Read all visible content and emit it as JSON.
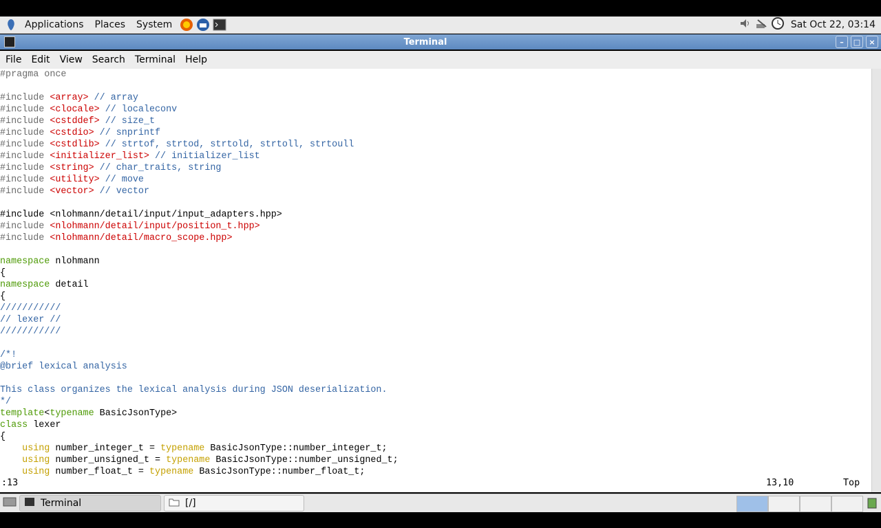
{
  "topbar": {
    "menus": [
      "Applications",
      "Places",
      "System"
    ],
    "clock": "Sat Oct 22, 03:14"
  },
  "window": {
    "title": "Terminal"
  },
  "menubar": [
    "File",
    "Edit",
    "View",
    "Search",
    "Terminal",
    "Help"
  ],
  "code": [
    [
      {
        "t": "#pragma once",
        "c": "pre"
      }
    ],
    [],
    [
      {
        "t": "#include ",
        "c": "pre"
      },
      {
        "t": "<array>",
        "c": "str"
      },
      {
        "t": " // array",
        "c": "com"
      }
    ],
    [
      {
        "t": "#include ",
        "c": "pre"
      },
      {
        "t": "<clocale>",
        "c": "str"
      },
      {
        "t": " // localeconv",
        "c": "com"
      }
    ],
    [
      {
        "t": "#include ",
        "c": "pre"
      },
      {
        "t": "<cstddef>",
        "c": "str"
      },
      {
        "t": " // size_t",
        "c": "com"
      }
    ],
    [
      {
        "t": "#include ",
        "c": "pre"
      },
      {
        "t": "<cstdio>",
        "c": "str"
      },
      {
        "t": " // snprintf",
        "c": "com"
      }
    ],
    [
      {
        "t": "#include ",
        "c": "pre"
      },
      {
        "t": "<cstdlib>",
        "c": "str"
      },
      {
        "t": " // strtof, strtod, strtold, strtoll, strtoull",
        "c": "com"
      }
    ],
    [
      {
        "t": "#include ",
        "c": "pre"
      },
      {
        "t": "<initializer_list>",
        "c": "str"
      },
      {
        "t": " // initializer_list",
        "c": "com"
      }
    ],
    [
      {
        "t": "#include ",
        "c": "pre"
      },
      {
        "t": "<string>",
        "c": "str"
      },
      {
        "t": " // char_traits, string",
        "c": "com"
      }
    ],
    [
      {
        "t": "#include ",
        "c": "pre"
      },
      {
        "t": "<utility>",
        "c": "str"
      },
      {
        "t": " // move",
        "c": "com"
      }
    ],
    [
      {
        "t": "#include ",
        "c": "pre"
      },
      {
        "t": "<vector>",
        "c": "str"
      },
      {
        "t": " // vector",
        "c": "com"
      }
    ],
    [],
    [
      {
        "t": "#include ",
        "c": "norm"
      },
      {
        "t": "<",
        "c": "cursor"
      },
      {
        "t": "nlohmann/detail/input/input_adapters.hpp>",
        "c": "norm"
      }
    ],
    [
      {
        "t": "#include ",
        "c": "pre"
      },
      {
        "t": "<nlohmann/detail/input/position_t.hpp>",
        "c": "str"
      }
    ],
    [
      {
        "t": "#include ",
        "c": "pre"
      },
      {
        "t": "<nlohmann/detail/macro_scope.hpp>",
        "c": "str"
      }
    ],
    [],
    [
      {
        "t": "namespace",
        "c": "kw"
      },
      {
        "t": " nlohmann",
        "c": "norm"
      }
    ],
    [
      {
        "t": "{",
        "c": "norm"
      }
    ],
    [
      {
        "t": "namespace",
        "c": "kw"
      },
      {
        "t": " detail",
        "c": "norm"
      }
    ],
    [
      {
        "t": "{",
        "c": "norm"
      }
    ],
    [
      {
        "t": "///////////",
        "c": "com"
      }
    ],
    [
      {
        "t": "// lexer //",
        "c": "com"
      }
    ],
    [
      {
        "t": "///////////",
        "c": "com"
      }
    ],
    [],
    [
      {
        "t": "/*!",
        "c": "com"
      }
    ],
    [
      {
        "t": "@brief lexical analysis",
        "c": "com"
      }
    ],
    [],
    [
      {
        "t": "This class organizes the lexical analysis during JSON deserialization.",
        "c": "com"
      }
    ],
    [
      {
        "t": "*/",
        "c": "com"
      }
    ],
    [
      {
        "t": "template",
        "c": "kw"
      },
      {
        "t": "<",
        "c": "norm"
      },
      {
        "t": "typename",
        "c": "kw"
      },
      {
        "t": " BasicJsonType>",
        "c": "norm"
      }
    ],
    [
      {
        "t": "class",
        "c": "kw"
      },
      {
        "t": " lexer",
        "c": "norm"
      }
    ],
    [
      {
        "t": "{",
        "c": "norm"
      }
    ],
    [
      {
        "t": "    ",
        "c": "norm"
      },
      {
        "t": "using",
        "c": "type"
      },
      {
        "t": " number_integer_t = ",
        "c": "norm"
      },
      {
        "t": "typename",
        "c": "type"
      },
      {
        "t": " BasicJsonType::number_integer_t;",
        "c": "norm"
      }
    ],
    [
      {
        "t": "    ",
        "c": "norm"
      },
      {
        "t": "using",
        "c": "type"
      },
      {
        "t": " number_unsigned_t = ",
        "c": "norm"
      },
      {
        "t": "typename",
        "c": "type"
      },
      {
        "t": " BasicJsonType::number_unsigned_t;",
        "c": "norm"
      }
    ],
    [
      {
        "t": "    ",
        "c": "norm"
      },
      {
        "t": "using",
        "c": "type"
      },
      {
        "t": " number_float_t = ",
        "c": "norm"
      },
      {
        "t": "typename",
        "c": "type"
      },
      {
        "t": " BasicJsonType::number_float_t;",
        "c": "norm"
      }
    ]
  ],
  "status": {
    "command": ":13",
    "position": "13,10",
    "scroll": "Top"
  },
  "taskbar": {
    "tasks": [
      {
        "label": "Terminal",
        "active": true
      },
      {
        "label": "[/]",
        "active": false
      }
    ]
  }
}
